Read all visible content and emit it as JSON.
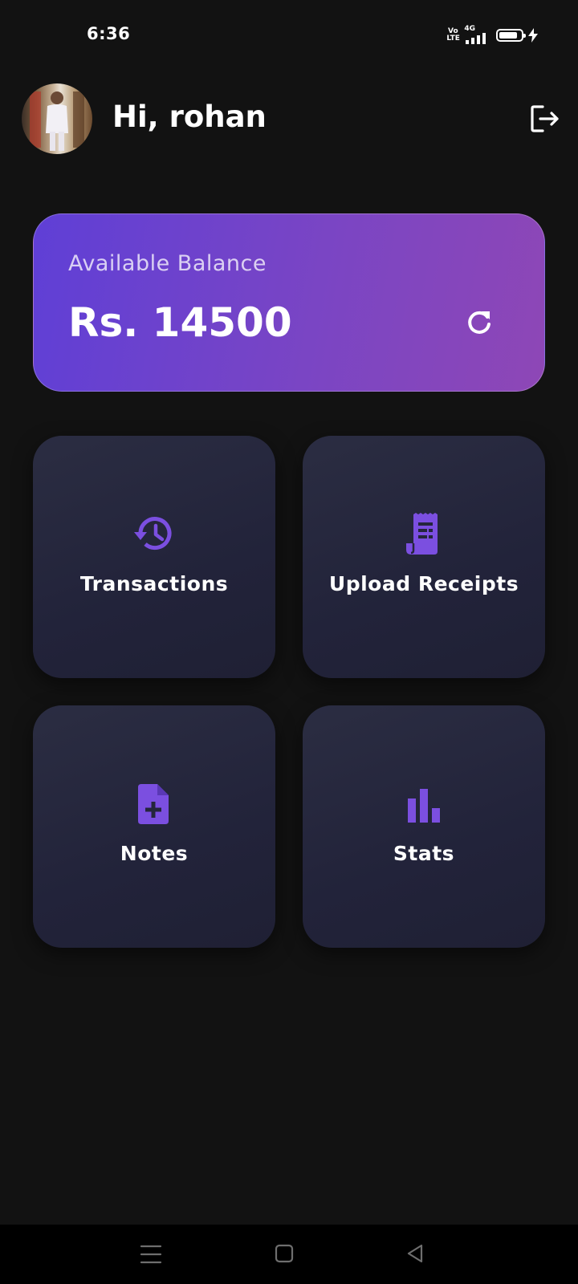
{
  "status_bar": {
    "time": "6:36",
    "volte_top": "Vo",
    "volte_bottom": "LTE",
    "network": "4G",
    "battery_level": 0.85
  },
  "header": {
    "greeting": "Hi, rohan",
    "avatar_icon": "user-avatar",
    "logout_icon": "logout-icon"
  },
  "balance": {
    "label": "Available Balance",
    "amount": "Rs. 14500",
    "refresh_icon": "refresh-icon"
  },
  "tiles": [
    {
      "label": "Transactions",
      "icon": "history-icon"
    },
    {
      "label": "Upload Receipts",
      "icon": "receipt-icon"
    },
    {
      "label": "Notes",
      "icon": "note-add-icon"
    },
    {
      "label": "Stats",
      "icon": "bar-chart-icon"
    }
  ],
  "nav": {
    "menu_icon": "menu-icon",
    "home_icon": "home-square-icon",
    "back_icon": "back-triangle-icon"
  },
  "colors": {
    "background": "#121212",
    "accent": "#7b4fe0",
    "card_gradient_start": "#5f3fd6",
    "card_gradient_end": "#8e47b6",
    "tile": "#25263c"
  }
}
